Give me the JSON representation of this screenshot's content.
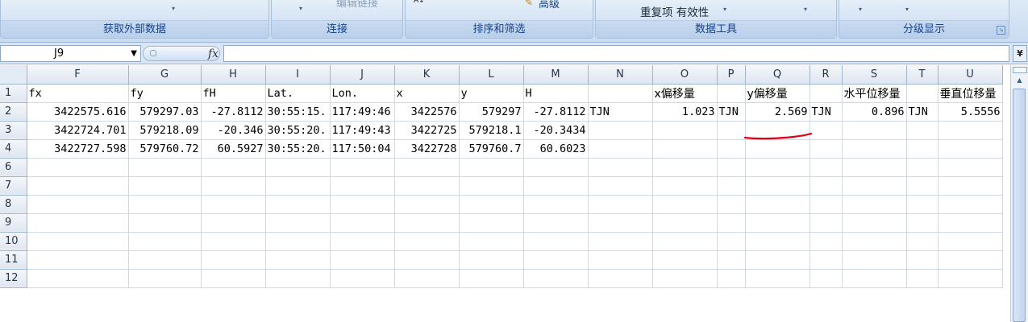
{
  "ribbon": {
    "groups": [
      {
        "label": "获取外部数据"
      },
      {
        "label": "连接",
        "cmd": "编辑链接"
      },
      {
        "label": "排序和筛选",
        "cmd": "高级",
        "sort_glyph": "A↓"
      },
      {
        "label": "数据工具",
        "cmd": "重复项 有效性"
      },
      {
        "label": "分级显示"
      }
    ],
    "dropdown_glyph": "▾",
    "launcher_glyph": "↘"
  },
  "formula_bar": {
    "name_box": "J9",
    "fx_label": "fx",
    "formula": "",
    "expand_glyph": "¥"
  },
  "sheet": {
    "columns": [
      "F",
      "G",
      "H",
      "I",
      "J",
      "K",
      "L",
      "M",
      "N",
      "O",
      "P",
      "Q",
      "R",
      "S",
      "T",
      "U"
    ],
    "row_numbers": [
      "1",
      "2",
      "3",
      "4",
      "6",
      "7",
      "8",
      "9",
      "10",
      "11",
      "12"
    ],
    "rows": [
      [
        "fx",
        "fy",
        "fH",
        "Lat.",
        "Lon.",
        "x",
        "y",
        "H",
        "",
        "x偏移量",
        "",
        "y偏移量",
        "",
        "水平位移量",
        "",
        "垂直位移量"
      ],
      [
        "3422575.616",
        "579297.03",
        "-27.8112",
        "30:55:15.",
        "117:49:46",
        "3422576",
        "579297",
        "-27.8112",
        "TJN",
        "1.023",
        "TJN",
        "2.569",
        "TJN",
        "0.896",
        "TJN",
        "5.5556"
      ],
      [
        "3422724.701",
        "579218.09",
        "-20.346",
        "30:55:20.",
        "117:49:43",
        "3422725",
        "579218.1",
        "-20.3434",
        "",
        "",
        "",
        "",
        "",
        "",
        "",
        ""
      ],
      [
        "3422727.598",
        "579760.72",
        "60.5927",
        "30:55:20.",
        "117:50:04",
        "3422728",
        "579760.7",
        "60.6023",
        "",
        "",
        "",
        "",
        "",
        "",
        "",
        ""
      ],
      [
        "",
        "",
        "",
        "",
        "",
        "",
        "",
        "",
        "",
        "",
        "",
        "",
        "",
        "",
        "",
        ""
      ],
      [
        "",
        "",
        "",
        "",
        "",
        "",
        "",
        "",
        "",
        "",
        "",
        "",
        "",
        "",
        "",
        ""
      ],
      [
        "",
        "",
        "",
        "",
        "",
        "",
        "",
        "",
        "",
        "",
        "",
        "",
        "",
        "",
        "",
        ""
      ],
      [
        "",
        "",
        "",
        "",
        "",
        "",
        "",
        "",
        "",
        "",
        "",
        "",
        "",
        "",
        "",
        ""
      ],
      [
        "",
        "",
        "",
        "",
        "",
        "",
        "",
        "",
        "",
        "",
        "",
        "",
        "",
        "",
        "",
        ""
      ],
      [
        "",
        "",
        "",
        "",
        "",
        "",
        "",
        "",
        "",
        "",
        "",
        "",
        "",
        "",
        "",
        ""
      ],
      [
        "",
        "",
        "",
        "",
        "",
        "",
        "",
        "",
        "",
        "",
        "",
        "",
        "",
        "",
        "",
        ""
      ]
    ],
    "annotation_color": "#e0001b"
  }
}
